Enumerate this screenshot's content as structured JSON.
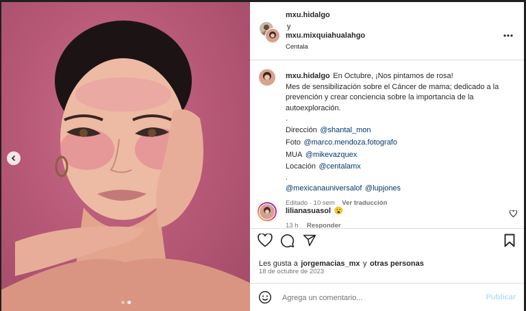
{
  "header": {
    "user1": "mxu.hidalgo",
    "conjunction": "y",
    "user2": "mxu.mixquiahualahgo",
    "audio": "Centala"
  },
  "caption": {
    "username": "mxu.hidalgo",
    "line1": "En Octubre, ¡Nos pintamos de rosa!",
    "line2": "Mes de sensibilización sobre el Cáncer de mama; dedicado a la",
    "line3": "prevención y crear conciencia sobre la importancia de la",
    "line4": "autoexploración.",
    "dot1": ".",
    "credits": [
      {
        "label": "Dirección",
        "handle": "@shantal_mon"
      },
      {
        "label": "Foto",
        "handle": "@marco.mendoza.fotografo"
      },
      {
        "label": "MUA",
        "handle": "@mikevazquex"
      },
      {
        "label": "Locación",
        "handle": "@centalamx"
      }
    ],
    "dot2": ".",
    "tag1": "@mexicanauniversalof",
    "tag2": "@lupjones",
    "meta": "Editado · 10 sem",
    "translate": "Ver traducción"
  },
  "comment": {
    "username": "lilianasuasol",
    "emoji": "😮",
    "time": "13 h",
    "reply": "Responder"
  },
  "actions": {
    "likes_prefix": "Les gusta a",
    "likes_user": "jorgemacias_mx",
    "likes_and": "y",
    "likes_others": "otras personas",
    "date": "18 de octubre de 2023"
  },
  "composer": {
    "placeholder": "Agrega un comentario...",
    "publish": "Publicar"
  },
  "colors": {
    "background_pink": "#b85a78",
    "link": "#00376b",
    "publish_disabled": "#b2dffc"
  }
}
